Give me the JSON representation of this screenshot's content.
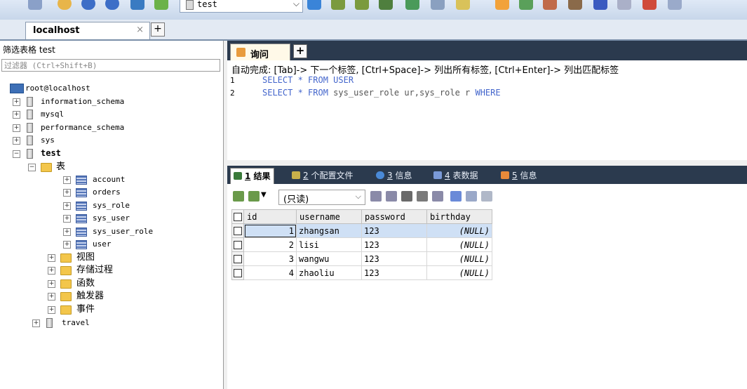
{
  "toolbar": {
    "database_select": "test",
    "icons": [
      "connection-icon",
      "new-connection-icon",
      "backup-icon",
      "restore-icon",
      "refresh-icon",
      "schema-icon",
      "database-icon",
      "query-icon",
      "new-query-icon",
      "execute-icon",
      "table-icon",
      "view-icon",
      "designer-icon",
      "tools-icon",
      "import-icon",
      "export-icon",
      "sync-icon",
      "user-icon",
      "report-icon",
      "scheduler-icon"
    ]
  },
  "connection_tab": {
    "label": "localhost",
    "close": "×",
    "add": "+"
  },
  "sidebar": {
    "filter_label": "筛选表格 test",
    "filter_placeholder": "过滤器 (Ctrl+Shift+B)",
    "server": "root@localhost",
    "databases": [
      {
        "name": "information_schema",
        "expanded": "+"
      },
      {
        "name": "mysql",
        "expanded": "+"
      },
      {
        "name": "performance_schema",
        "expanded": "+"
      },
      {
        "name": "sys",
        "expanded": "+"
      },
      {
        "name": "test",
        "expanded": "−"
      }
    ],
    "tables_folder": "表",
    "tables": [
      "account",
      "orders",
      "sys_role",
      "sys_user",
      "sys_user_role",
      "user"
    ],
    "folders": [
      "视图",
      "存储过程",
      "函数",
      "触发器",
      "事件"
    ],
    "other_database": "travel"
  },
  "query": {
    "tab_label": "询问",
    "add": "+",
    "hint": "自动完成: [Tab]-> 下一个标签, [Ctrl+Space]-> 列出所有标签, [Ctrl+Enter]-> 列出匹配标签",
    "line_numbers": [
      "1",
      "2"
    ],
    "lines": [
      {
        "kw1": "SELECT",
        "star": " * ",
        "kw2": "FROM",
        "rest": " USER"
      },
      {
        "kw1": "SELECT",
        "star": " * ",
        "kw2": "FROM",
        "rest": " sys_user_role ur,sys_role r ",
        "kw3": "WHERE"
      }
    ]
  },
  "results_tabs": [
    {
      "num": "1",
      "label": "结果",
      "active": true
    },
    {
      "num": "2",
      "label": "个配置文件",
      "active": false
    },
    {
      "num": "3",
      "label": "信息",
      "active": false
    },
    {
      "num": "4",
      "label": "表数据",
      "active": false
    },
    {
      "num": "5",
      "label": "信息",
      "active": false
    }
  ],
  "results": {
    "mode": "(只读)",
    "columns": [
      "id",
      "username",
      "password",
      "birthday"
    ],
    "rows": [
      {
        "id": "1",
        "username": "zhangsan",
        "password": "123",
        "birthday": "(NULL)"
      },
      {
        "id": "2",
        "username": "lisi",
        "password": "123",
        "birthday": "(NULL)"
      },
      {
        "id": "3",
        "username": "wangwu",
        "password": "123",
        "birthday": "(NULL)"
      },
      {
        "id": "4",
        "username": "zhaoliu",
        "password": "123",
        "birthday": "(NULL)"
      }
    ]
  },
  "colors": {
    "accent": "#2b3a4e",
    "selection": "#cfe0f5",
    "keyword": "#4466cc"
  }
}
